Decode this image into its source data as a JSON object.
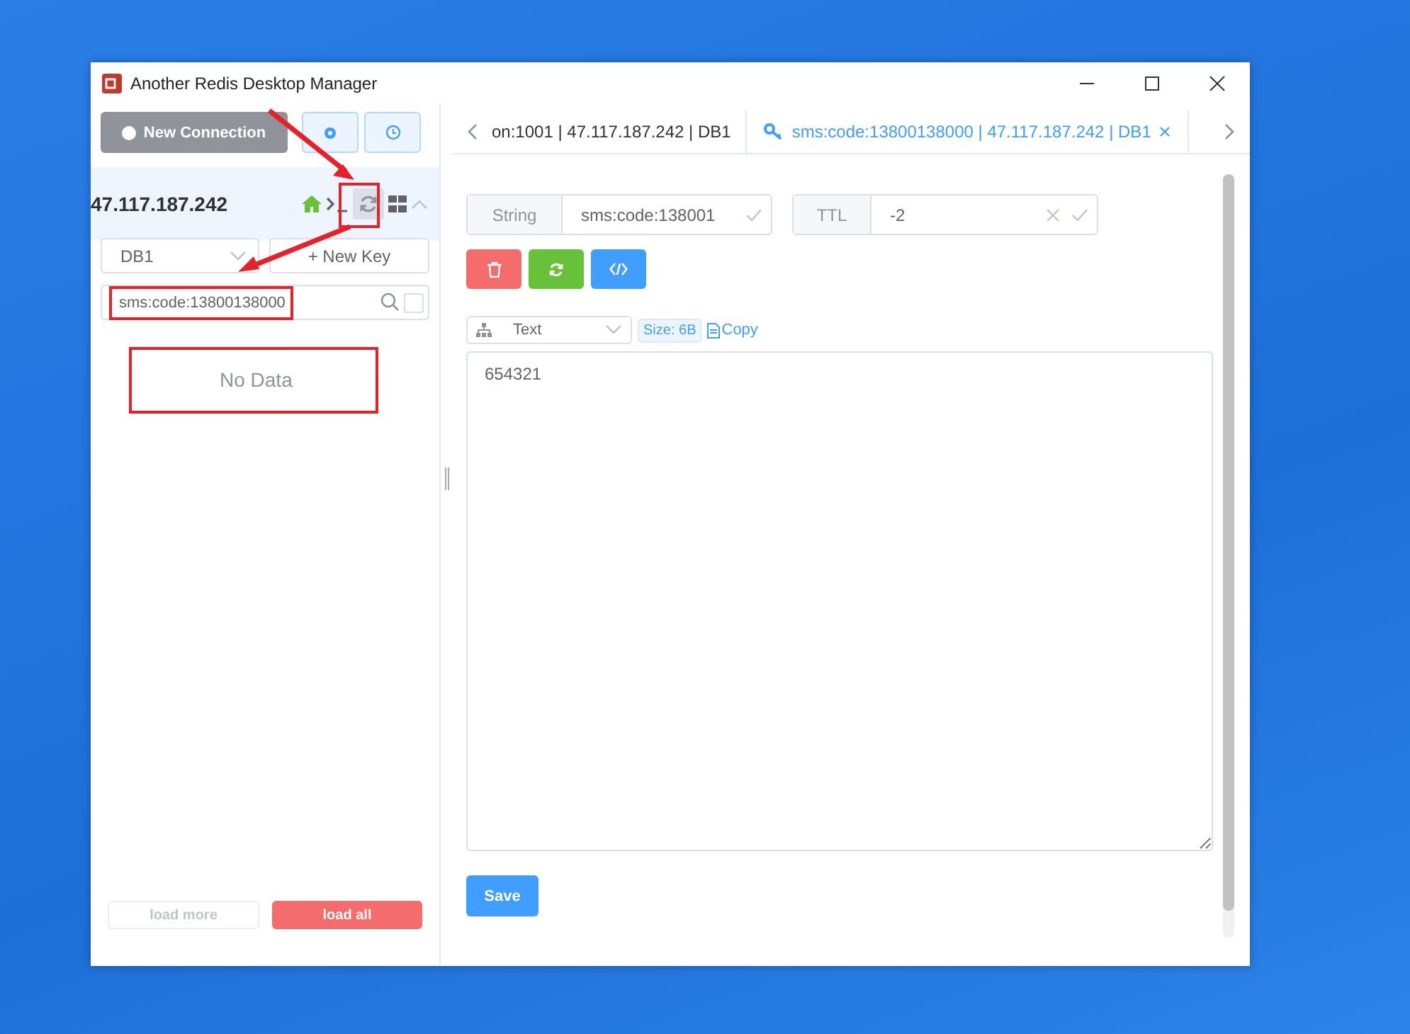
{
  "window": {
    "title": "Another Redis Desktop Manager"
  },
  "sidebar": {
    "new_connection": "New Connection",
    "server": {
      "name": "47.117.187.242",
      "expanded": true
    },
    "db_select": {
      "value": "DB1"
    },
    "new_key": "+ New Key",
    "search": {
      "value": "sms:code:13800138000",
      "exact": false
    },
    "empty": "No Data",
    "load_more": {
      "label": "load more",
      "disabled": true
    },
    "load_all": "load all"
  },
  "tabs": [
    {
      "label": "on:1001 | 47.117.187.242 | DB1",
      "selected": false
    },
    {
      "label": "sms:code:13800138000 | 47.117.187.242 | DB1",
      "selected": true
    }
  ],
  "key_detail": {
    "type": "String",
    "key_name": "sms:code:138001",
    "ttl_label": "TTL",
    "ttl": "-2",
    "format": "Text",
    "size": "Size: 6B",
    "copy": "Copy",
    "value": "654321",
    "save": "Save"
  }
}
